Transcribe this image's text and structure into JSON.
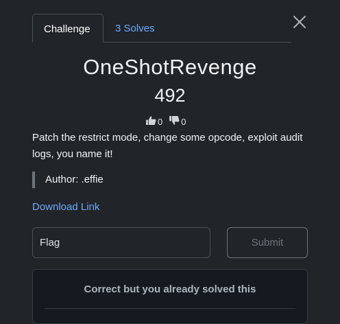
{
  "tabs": [
    {
      "label": "Challenge"
    },
    {
      "label": "3 Solves"
    }
  ],
  "challenge": {
    "title": "OneShotRevenge",
    "points": "492",
    "upvotes": "0",
    "downvotes": "0",
    "description": "Patch the restrict mode, change some opcode, exploit audit logs, you name it!",
    "author": "Author: .effie",
    "download_label": "Download Link"
  },
  "form": {
    "flag_placeholder": "Flag",
    "submit_label": "Submit"
  },
  "result": {
    "message": "Correct but you already solved this"
  },
  "colors": {
    "background": "#212428",
    "link": "#6ea8fe",
    "result_bg": "#151a21"
  },
  "icons": {
    "close": "close-icon",
    "upvote": "thumbs-up-icon",
    "downvote": "thumbs-down-icon"
  }
}
